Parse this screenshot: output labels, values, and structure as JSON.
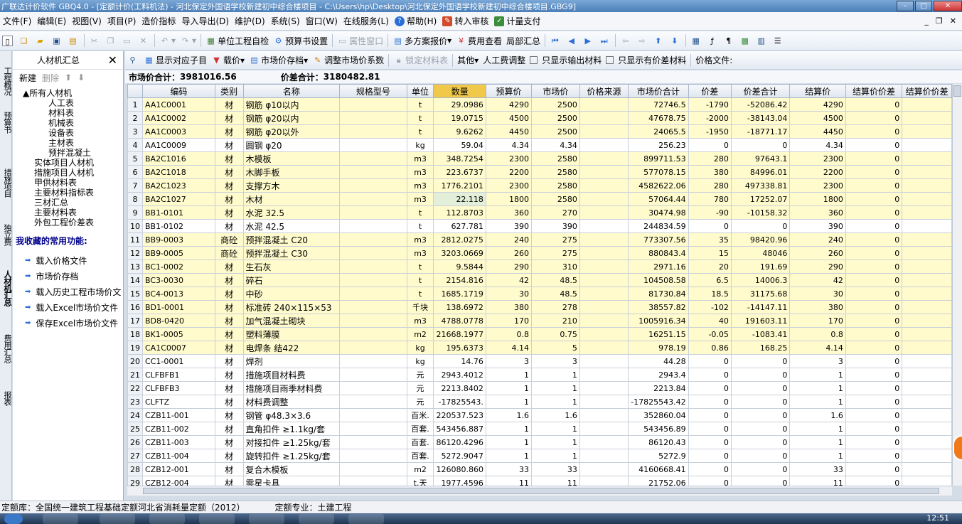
{
  "title": "广联达计价软件 GBQ4.0 - [定额计价(工料机法) - 河北保定外国语学校新建初中综合楼项目 - C:\\Users\\hp\\Desktop\\河北保定外国语学校新建初中综合楼项目.GBG9]",
  "menu": [
    "文件(F)",
    "编辑(E)",
    "视图(V)",
    "项目(P)",
    "造价指标",
    "导入导出(D)",
    "维护(D)",
    "系统(S)",
    "窗口(W)",
    "在线服务(L)",
    "帮助(H)",
    "转入审核",
    "计量支付"
  ],
  "toolbar1": {
    "check": "单位工程自检",
    "budget_settings": "预算书设置",
    "attr_window": "属性窗口",
    "multi_plan": "多方案报价",
    "fee_view": "费用查看",
    "partial_sum": "局部汇总"
  },
  "vtabs": [
    "工程概况",
    "预算书",
    "措施项目",
    "独立费",
    "人材机汇总",
    "费用汇总",
    "报表"
  ],
  "left": {
    "title": "人材机汇总",
    "close": "✕",
    "new": "新建",
    "delete": "删除",
    "tree": [
      "所有人材机",
      "人工表",
      "材料表",
      "机械表",
      "设备表",
      "主材表",
      "预拌混凝土",
      "实体项目人材机",
      "措施项目人材机",
      "甲供材料表",
      "主要材料指标表",
      "三材汇总",
      "主要材料表",
      "外包工程价差表"
    ],
    "fav_title": "我收藏的常用功能:",
    "fav": [
      "载入价格文件",
      "市场价存档",
      "载入历史工程市场价文",
      "载入Excel市场价文件",
      "保存Excel市场价文件"
    ]
  },
  "toolbar2": {
    "show_sub": "显示对应子目",
    "load_price": "载价",
    "market_save": "市场价存档",
    "adjust_coef": "调整市场价系数",
    "lock_table": "锁定材料表",
    "other": "其他",
    "labor_adjust": "人工费调整",
    "only_output": "只显示输出材料",
    "only_diff": "只显示有价差材料",
    "price_file": "价格文件:"
  },
  "summary": {
    "market_label": "市场价合计：",
    "market_total": "3981016.56",
    "diff_label": "价差合计：",
    "diff_total": "3180482.81"
  },
  "columns": [
    "",
    "编码",
    "类别",
    "名称",
    "规格型号",
    "单位",
    "数量",
    "预算价",
    "市场价",
    "价格来源",
    "市场价合计",
    "价差",
    "价差合计",
    "结算价",
    "结算价价差",
    "结算价价差"
  ],
  "rows": [
    [
      "1",
      "AA1C0001",
      "材",
      "钢筋 φ10以内",
      "",
      "t",
      "29.0986",
      "4290",
      "2500",
      "",
      "72746.5",
      "-1790",
      "-52086.42",
      "4290",
      "0",
      "y"
    ],
    [
      "2",
      "AA1C0002",
      "材",
      "钢筋 φ20以内",
      "",
      "t",
      "19.0715",
      "4500",
      "2500",
      "",
      "47678.75",
      "-2000",
      "-38143.04",
      "4500",
      "0",
      "y"
    ],
    [
      "3",
      "AA1C0003",
      "材",
      "钢筋 φ20以外",
      "",
      "t",
      "9.6262",
      "4450",
      "2500",
      "",
      "24065.5",
      "-1950",
      "-18771.17",
      "4450",
      "0",
      "y"
    ],
    [
      "4",
      "AA1C0009",
      "材",
      "圆钢 φ20",
      "",
      "kg",
      "59.04",
      "4.34",
      "4.34",
      "",
      "256.23",
      "0",
      "0",
      "4.34",
      "0",
      "w"
    ],
    [
      "5",
      "BA2C1016",
      "材",
      "木模板",
      "",
      "m3",
      "348.7254",
      "2300",
      "2580",
      "",
      "899711.53",
      "280",
      "97643.1",
      "2300",
      "0",
      "y"
    ],
    [
      "6",
      "BA2C1018",
      "材",
      "木脚手板",
      "",
      "m3",
      "223.6737",
      "2200",
      "2580",
      "",
      "577078.15",
      "380",
      "84996.01",
      "2200",
      "0",
      "y"
    ],
    [
      "7",
      "BA2C1023",
      "材",
      "支撑方木",
      "",
      "m3",
      "1776.2101",
      "2300",
      "2580",
      "",
      "4582622.06",
      "280",
      "497338.81",
      "2300",
      "0",
      "y"
    ],
    [
      "8",
      "BA2C1027",
      "材",
      "木材",
      "",
      "m3",
      "22.118",
      "1800",
      "2580",
      "",
      "57064.44",
      "780",
      "17252.07",
      "1800",
      "0",
      "y"
    ],
    [
      "9",
      "BB1-0101",
      "材",
      "水泥 32.5",
      "",
      "t",
      "112.8703",
      "360",
      "270",
      "",
      "30474.98",
      "-90",
      "-10158.32",
      "360",
      "0",
      "y"
    ],
    [
      "10",
      "BB1-0102",
      "材",
      "水泥 42.5",
      "",
      "t",
      "627.781",
      "390",
      "390",
      "",
      "244834.59",
      "0",
      "0",
      "390",
      "0",
      "w"
    ],
    [
      "11",
      "BB9-0003",
      "商砼",
      "预拌混凝土 C20",
      "",
      "m3",
      "2812.0275",
      "240",
      "275",
      "",
      "773307.56",
      "35",
      "98420.96",
      "240",
      "0",
      "y"
    ],
    [
      "12",
      "BB9-0005",
      "商砼",
      "预拌混凝土 C30",
      "",
      "m3",
      "3203.0669",
      "260",
      "275",
      "",
      "880843.4",
      "15",
      "48046",
      "260",
      "0",
      "y"
    ],
    [
      "13",
      "BC1-0002",
      "材",
      "生石灰",
      "",
      "t",
      "9.5844",
      "290",
      "310",
      "",
      "2971.16",
      "20",
      "191.69",
      "290",
      "0",
      "y"
    ],
    [
      "14",
      "BC3-0030",
      "材",
      "碎石",
      "",
      "t",
      "2154.816",
      "42",
      "48.5",
      "",
      "104508.58",
      "6.5",
      "14006.3",
      "42",
      "0",
      "y"
    ],
    [
      "15",
      "BC4-0013",
      "材",
      "中砂",
      "",
      "t",
      "1685.1719",
      "30",
      "48.5",
      "",
      "81730.84",
      "18.5",
      "31175.68",
      "30",
      "0",
      "y"
    ],
    [
      "16",
      "BD1-0001",
      "材",
      "标准砖 240×115×53",
      "",
      "千块",
      "138.6972",
      "380",
      "278",
      "",
      "38557.82",
      "-102",
      "-14147.11",
      "380",
      "0",
      "y"
    ],
    [
      "17",
      "BD8-0420",
      "材",
      "加气混凝土砌块",
      "",
      "m3",
      "4788.0778",
      "170",
      "210",
      "",
      "1005916.34",
      "40",
      "191603.11",
      "170",
      "0",
      "y"
    ],
    [
      "18",
      "BK1-0005",
      "材",
      "塑料薄膜",
      "",
      "m2",
      "21668.1977",
      "0.8",
      "0.75",
      "",
      "16251.15",
      "-0.05",
      "-1083.41",
      "0.8",
      "0",
      "y"
    ],
    [
      "19",
      "CA1C0007",
      "材",
      "电焊条 结422",
      "",
      "kg",
      "195.6373",
      "4.14",
      "5",
      "",
      "978.19",
      "0.86",
      "168.25",
      "4.14",
      "0",
      "y"
    ],
    [
      "20",
      "CC1-0001",
      "材",
      "焊剂",
      "",
      "kg",
      "14.76",
      "3",
      "3",
      "",
      "44.28",
      "0",
      "0",
      "3",
      "0",
      "w"
    ],
    [
      "21",
      "CLFBFB1",
      "材",
      "措施项目材料费",
      "",
      "元",
      "2943.4012",
      "1",
      "1",
      "",
      "2943.4",
      "0",
      "0",
      "1",
      "0",
      "w"
    ],
    [
      "22",
      "CLFBFB3",
      "材",
      "措施项目雨季材料费",
      "",
      "元",
      "2213.8402",
      "1",
      "1",
      "",
      "2213.84",
      "0",
      "0",
      "1",
      "0",
      "w"
    ],
    [
      "23",
      "CLFTZ",
      "材",
      "材料费调整",
      "",
      "元",
      "-17825543.",
      "1",
      "1",
      "",
      "-17825543.42",
      "0",
      "0",
      "1",
      "0",
      "w"
    ],
    [
      "24",
      "CZB11-001",
      "材",
      "钢管 φ48.3×3.6",
      "",
      "百米.",
      "220537.523",
      "1.6",
      "1.6",
      "",
      "352860.04",
      "0",
      "0",
      "1.6",
      "0",
      "w"
    ],
    [
      "25",
      "CZB11-002",
      "材",
      "直角扣件 ≥1.1kg/套",
      "",
      "百套.",
      "543456.887",
      "1",
      "1",
      "",
      "543456.89",
      "0",
      "0",
      "1",
      "0",
      "w"
    ],
    [
      "26",
      "CZB11-003",
      "材",
      "对接扣件 ≥1.25kg/套",
      "",
      "百套.",
      "86120.4296",
      "1",
      "1",
      "",
      "86120.43",
      "0",
      "0",
      "1",
      "0",
      "w"
    ],
    [
      "27",
      "CZB11-004",
      "材",
      "旋转扣件 ≥1.25kg/套",
      "",
      "百套.",
      "5272.9047",
      "1",
      "1",
      "",
      "5272.9",
      "0",
      "0",
      "1",
      "0",
      "w"
    ],
    [
      "28",
      "CZB12-001",
      "材",
      "复合木模板",
      "",
      "m2",
      "126080.860",
      "33",
      "33",
      "",
      "4160668.41",
      "0",
      "0",
      "33",
      "0",
      "w"
    ],
    [
      "29",
      "CZB12-004",
      "材",
      "零星卡具",
      "",
      "t.天",
      "1977.4596",
      "11",
      "11",
      "",
      "21752.06",
      "0",
      "0",
      "11",
      "0",
      "w"
    ]
  ],
  "status": {
    "quota_lib": "定额库：全国统一建筑工程基础定额河北省消耗量定额（2012）",
    "quota_major": "定额专业：土建工程"
  },
  "clock": "12:51"
}
